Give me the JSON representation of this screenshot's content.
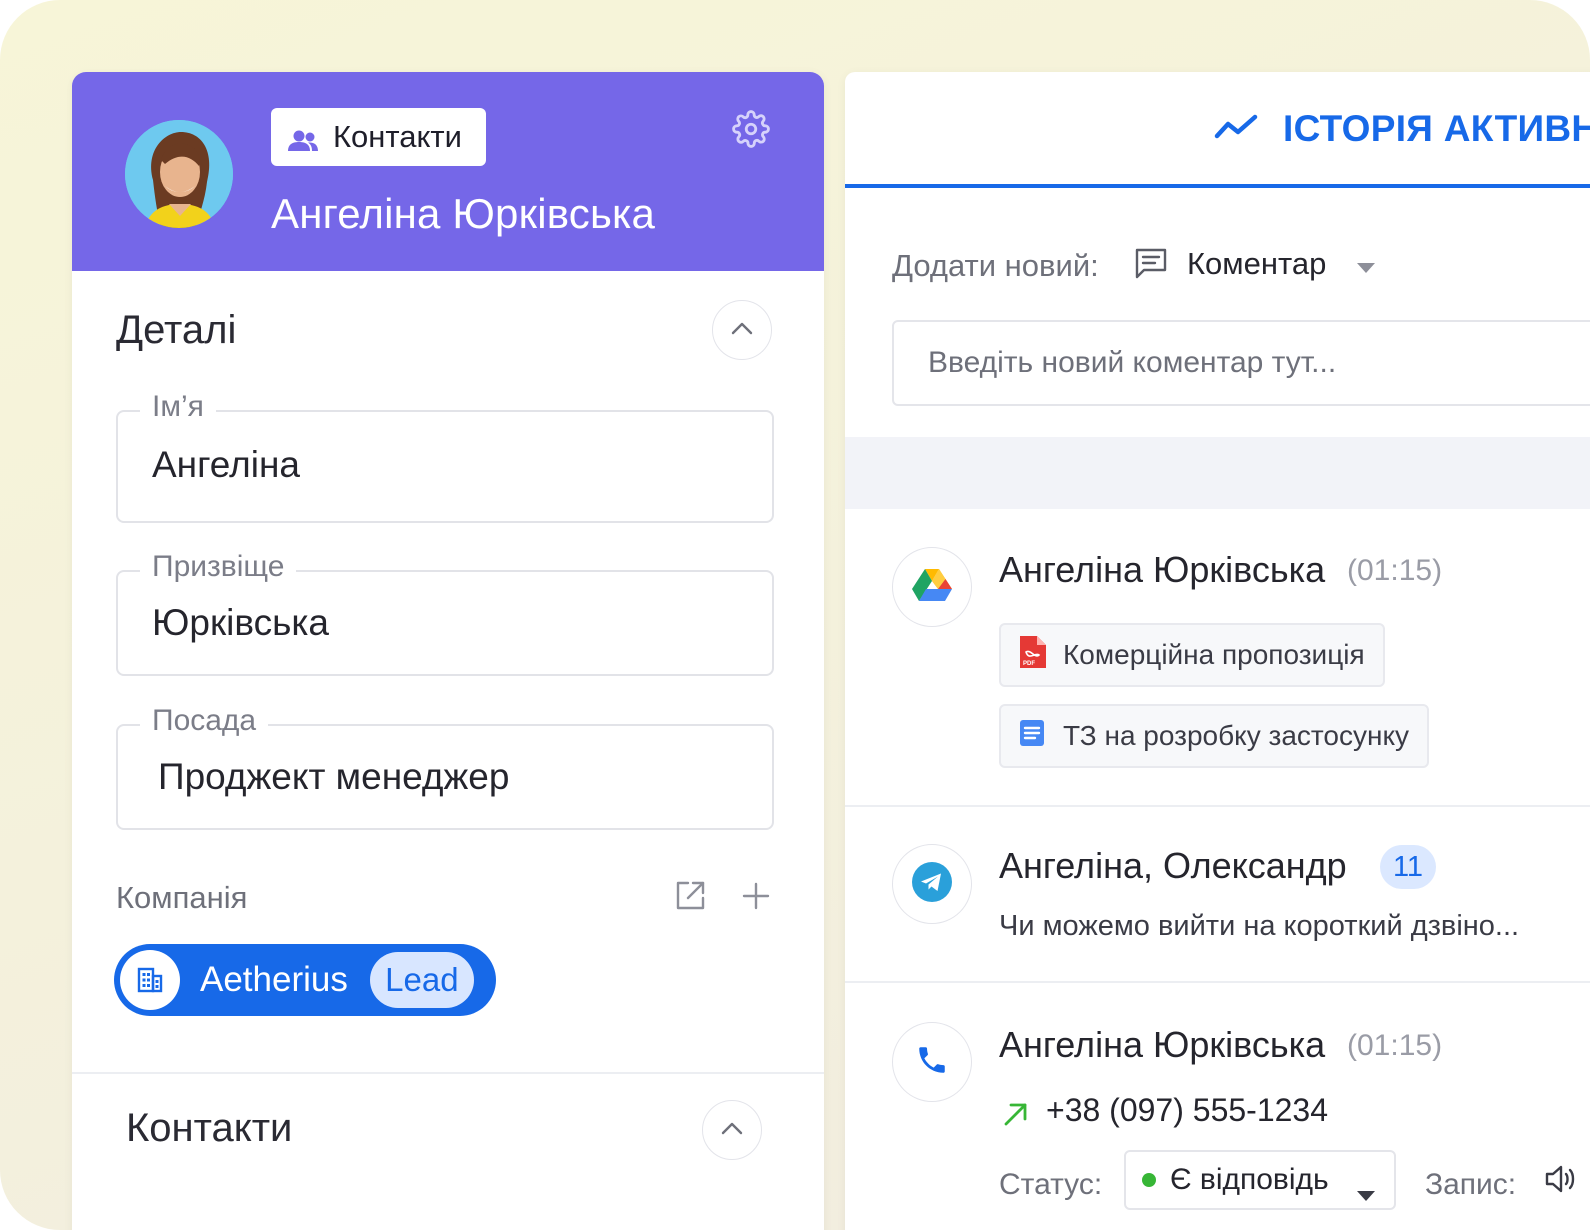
{
  "profile": {
    "chip_label": "Контакти",
    "name": "Ангеліна Юрківська"
  },
  "details": {
    "title": "Деталі",
    "fields": [
      {
        "label": "Ім’я",
        "value": "Ангеліна"
      },
      {
        "label": "Призвіще",
        "value": "Юрківська"
      },
      {
        "label": "Посада",
        "value": "Проджект менеджер"
      }
    ],
    "company_label": "Компанія",
    "company": {
      "name": "Aetherius",
      "tag": "Lead"
    }
  },
  "contacts_section": {
    "title": "Контакти"
  },
  "history": {
    "tab_title": "ІСТОРІЯ АКТИВНОСТІ",
    "add_label": "Додати новий:",
    "add_type": "Коментар",
    "comment_placeholder": "Введіть новий коментар тут...",
    "activities": [
      {
        "source_icon": "google-drive-icon",
        "author": "Ангеліна Юрківська",
        "time": "(01:15)",
        "files": [
          {
            "icon": "pdf-icon",
            "name": "Комерційна пропозиція"
          },
          {
            "icon": "doc-icon",
            "name": "ТЗ на розробку застосунку"
          }
        ]
      },
      {
        "source_icon": "telegram-icon",
        "author": "Ангеліна, Олександр",
        "badge": "11",
        "preview": "Чи можемо вийти на короткий дзвіно..."
      },
      {
        "source_icon": "phone-icon",
        "author": "Ангеліна Юрківська",
        "time": "(01:15)",
        "phone": "+38 (097) 555-1234",
        "status_label": "Статус:",
        "status_value": "Є відповідь",
        "record_label": "Запис:"
      }
    ]
  },
  "colors": {
    "header_purple": "#7567e8",
    "accent_blue": "#1769e8",
    "status_green": "#37b636"
  }
}
